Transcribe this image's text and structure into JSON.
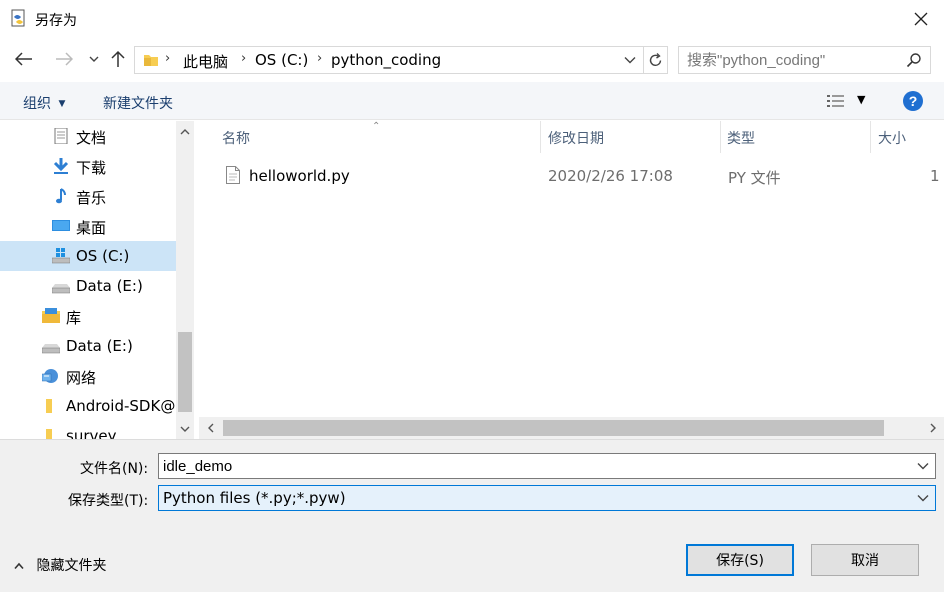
{
  "window": {
    "title": "另存为",
    "close": "✕"
  },
  "nav": {
    "breadcrumb": [
      "此电脑",
      "OS (C:)",
      "python_coding"
    ],
    "search_placeholder": "搜索\"python_coding\""
  },
  "toolbar": {
    "organize_label": "组织",
    "new_folder_label": "新建文件夹",
    "help_label": "?"
  },
  "tree": {
    "items": [
      {
        "label": "文档",
        "icon": "documents-icon"
      },
      {
        "label": "下载",
        "icon": "downloads-icon"
      },
      {
        "label": "音乐",
        "icon": "music-icon"
      },
      {
        "label": "桌面",
        "icon": "desktop-icon"
      },
      {
        "label": "OS (C:)",
        "icon": "windows-drive-icon",
        "selected": true
      },
      {
        "label": "Data (E:)",
        "icon": "drive-icon"
      },
      {
        "label": "库",
        "icon": "library-icon"
      },
      {
        "label": "Data (E:)",
        "icon": "drive-icon"
      },
      {
        "label": "网络",
        "icon": "network-icon"
      },
      {
        "label": "Android-SDK@",
        "icon": "folder-icon"
      },
      {
        "label": "survey",
        "icon": "folder-icon"
      }
    ]
  },
  "files": {
    "columns": [
      "名称",
      "修改日期",
      "类型",
      "大小"
    ],
    "rows": [
      {
        "name": "helloworld.py",
        "modified": "2020/2/26 17:08",
        "type": "PY 文件",
        "size": "1"
      }
    ]
  },
  "form": {
    "filename_label": "文件名(N):",
    "filename_value": "idle_demo",
    "filetype_label": "保存类型(T):",
    "filetype_value": "Python files (*.py;*.pyw)"
  },
  "footer": {
    "hide_folders_label": "隐藏文件夹",
    "save_label": "保存(S)",
    "cancel_label": "取消"
  },
  "colors": {
    "accent": "#0078d7",
    "selected_bg": "#cce4f7",
    "toolbar_text": "#1a3e6e",
    "help_blue": "#1f6fd1"
  }
}
